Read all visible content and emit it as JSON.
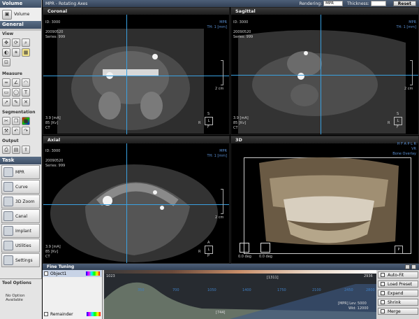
{
  "app": {
    "title": "MPR - Rotating Axes"
  },
  "topbar": {
    "rendering_label": "Rendering:",
    "rendering_value": "MPR",
    "thickness_label": "Thickness:",
    "reset": "Reset"
  },
  "sidebar": {
    "volume_header": "Volume",
    "volume_label": "Volume",
    "general_header": "General",
    "view_header": "View",
    "measure_header": "Measure",
    "segmentation_header": "Segmentation",
    "output_header": "Output",
    "task_header": "Task",
    "tasks": [
      "MPR",
      "Curve",
      "3D Zoom",
      "Canal",
      "Implant",
      "Utilities",
      "Settings"
    ],
    "tool_options_header": "Tool Options",
    "tool_options_text": "No Option Available"
  },
  "viewports": {
    "coronal": {
      "title": "Coronal",
      "id": "ID: 3000",
      "date": "20090520",
      "series": "Series: 999",
      "right1": "MPR",
      "right2": "TH: 1 [mm]",
      "ma": "3.9 [mA]",
      "kv": "85 [Kv]",
      "mod": "CT",
      "scale": "2 cm",
      "o_left": "R",
      "o_right": "L",
      "o_top": "S",
      "o_bottom": "F"
    },
    "sagittal": {
      "title": "Sagittal",
      "id": "ID: 3000",
      "date": "20090520",
      "series": "Series: 999",
      "right1": "MPR",
      "right2": "TH: 1 [mm]",
      "ma": "3.9 [mA]",
      "kv": "85 [Kv]",
      "mod": "CT",
      "scale": "2 cm",
      "o_left": "R",
      "o_right": "L",
      "o_top": "S",
      "o_bottom": "F"
    },
    "axial": {
      "title": "Axial",
      "id": "ID: 3000",
      "date": "20090520",
      "series": "Series: 999",
      "right1": "MPR",
      "right2": "TH: 1 [mm]",
      "ma": "3.9 [mA]",
      "kv": "85 [Kv]",
      "mod": "CT",
      "scale": "2 cm",
      "o_left": "R",
      "o_right": "L",
      "o_top": "A",
      "o_bottom": "P"
    },
    "threed": {
      "title": "3D",
      "right1": "H F A P L R",
      "right2": "VR",
      "right3": "Bone Overlay",
      "angle1": "0.0 deg",
      "angle2": "0.0 deg"
    }
  },
  "fine_tuning": {
    "title": "Fine Tuning",
    "objects": [
      "Object1",
      "Remainder"
    ],
    "ticks": [
      "1023",
      "350",
      "700",
      "1050",
      "1400",
      "1750",
      "2100",
      "2450",
      "2800"
    ],
    "bracket_top": "[1311]",
    "bracket_bottom": "[744]",
    "right_max": "2936",
    "mpr_lev": "[MPR] Lev:  5000",
    "wid": "Wid:  12000",
    "buttons": [
      "Auto-Fit",
      "Load Preset",
      "Expand",
      "Shrink",
      "Merge"
    ]
  }
}
